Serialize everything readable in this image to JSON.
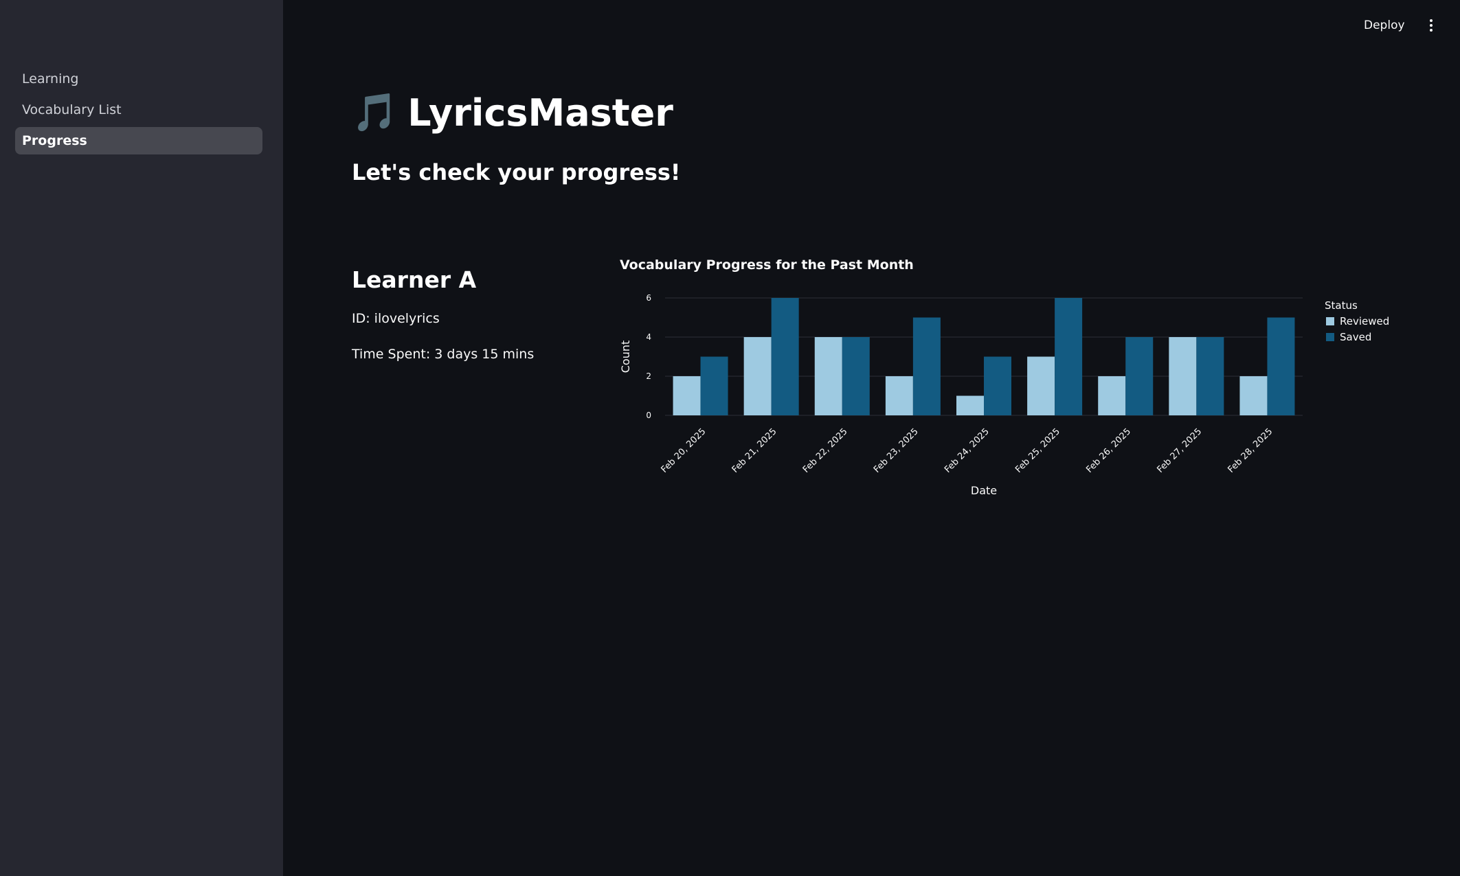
{
  "sidebar": {
    "items": [
      {
        "label": "Learning",
        "active": false
      },
      {
        "label": "Vocabulary List",
        "active": false
      },
      {
        "label": "Progress",
        "active": true
      }
    ]
  },
  "topbar": {
    "deploy_label": "Deploy",
    "menu_icon": "more-vertical-icon"
  },
  "header": {
    "title_icon": "🎵",
    "title": "LyricsMaster",
    "subtitle": "Let's check your progress!"
  },
  "learner": {
    "name": "Learner A",
    "id_text": "ID: ilovelyrics",
    "time_text": "Time Spent: 3 days 15 mins"
  },
  "colors": {
    "reviewed": "#9ecae1",
    "saved": "#135b82",
    "grid": "#2e3038"
  },
  "chart_data": {
    "type": "bar",
    "title": "Vocabulary Progress for the Past Month",
    "xlabel": "Date",
    "ylabel": "Count",
    "ylim": [
      0,
      6
    ],
    "yticks": [
      0,
      2,
      4,
      6
    ],
    "grid": true,
    "legend_title": "Status",
    "legend_position": "right",
    "categories": [
      "Feb 20, 2025",
      "Feb 21, 2025",
      "Feb 22, 2025",
      "Feb 23, 2025",
      "Feb 24, 2025",
      "Feb 25, 2025",
      "Feb 26, 2025",
      "Feb 27, 2025",
      "Feb 28, 2025"
    ],
    "series": [
      {
        "name": "Reviewed",
        "values": [
          2,
          4,
          4,
          2,
          1,
          3,
          2,
          4,
          2
        ]
      },
      {
        "name": "Saved",
        "values": [
          3,
          6,
          4,
          5,
          3,
          6,
          4,
          4,
          5
        ]
      }
    ]
  }
}
